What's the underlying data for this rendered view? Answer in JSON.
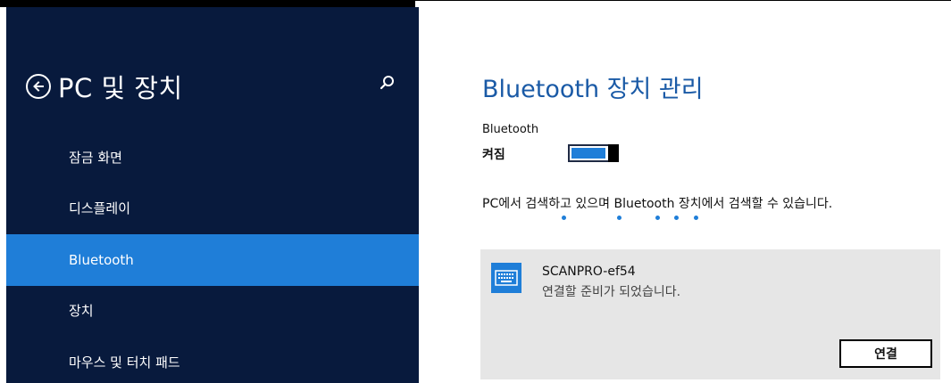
{
  "sidebar": {
    "title": "PC 및 장치",
    "items": [
      {
        "label": "잠금 화면",
        "selected": false
      },
      {
        "label": "디스플레이",
        "selected": false
      },
      {
        "label": "Bluetooth",
        "selected": true
      },
      {
        "label": "장치",
        "selected": false
      },
      {
        "label": "마우스 및 터치 패드",
        "selected": false
      }
    ]
  },
  "main": {
    "title": "Bluetooth 장치 관리",
    "bluetooth_label": "Bluetooth",
    "toggle_state": "켜짐",
    "toggle_on": true,
    "search_status": "PC에서 검색하고 있으며 Bluetooth 장치에서 검색할 수 있습니다.",
    "device": {
      "name": "SCANPRO-ef54",
      "status": "연결할 준비가 되었습니다.",
      "icon": "keyboard-icon",
      "connect_label": "연결"
    }
  },
  "icons": {
    "back": "back-arrow-icon",
    "search": "search-icon"
  },
  "colors": {
    "sidebar_bg": "#081a3d",
    "accent": "#1f7ed8",
    "title": "#1a5aa6",
    "card_bg": "#e6e6e6"
  }
}
